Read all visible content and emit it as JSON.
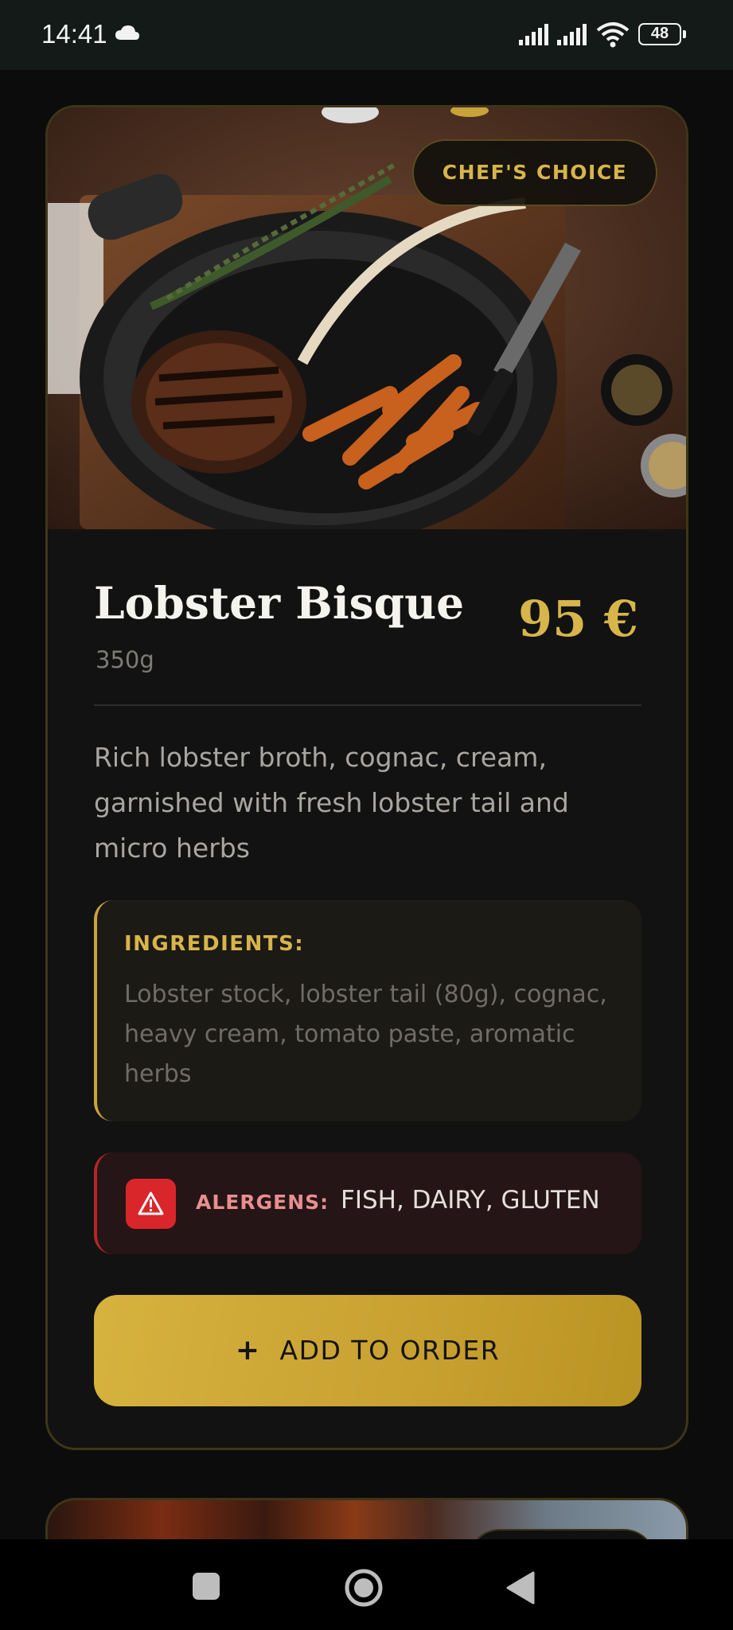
{
  "status_bar": {
    "time": "14:41",
    "battery": "48",
    "icons": [
      "cloud-icon",
      "signal-icon",
      "signal-icon",
      "wifi-icon",
      "battery-icon"
    ]
  },
  "dish": {
    "badge": "CHEF'S CHOICE",
    "name": "Lobster Bisque",
    "weight": "350g",
    "price": "95 €",
    "description": "Rich lobster broth, cognac, cream, garnished with fresh lobster tail and micro herbs",
    "ingredients_title": "INGREDIENTS:",
    "ingredients": "Lobster stock, lobster tail (80g), cognac, heavy cream, tomato paste, aromatic herbs",
    "allergens_label": "ALERGENS:",
    "allergens": "FISH, DAIRY, GLUTEN",
    "add_button": "ADD TO ORDER",
    "add_button_icon": "+"
  },
  "colors": {
    "accent_gold": "#d7b54a",
    "card_bg": "#121212",
    "allergen_red": "#d9262a"
  },
  "nav": {
    "icons": [
      "recents-square-icon",
      "home-circle-icon",
      "back-triangle-icon"
    ]
  }
}
